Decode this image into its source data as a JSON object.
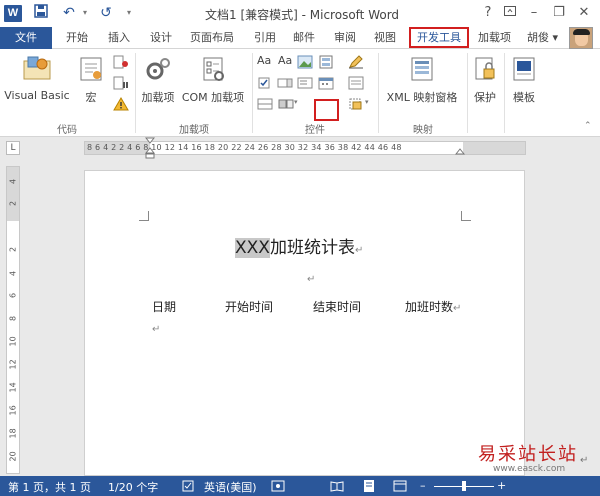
{
  "window": {
    "title": "文档1 [兼容模式] - Microsoft Word",
    "logo": "W",
    "undo": "↶",
    "redo": "↺",
    "help": "?",
    "minimize": "–",
    "restore": "❐",
    "close": "✕"
  },
  "tabs": {
    "file": "文件",
    "home": "开始",
    "insert": "插入",
    "design": "设计",
    "layout": "页面布局",
    "references": "引用",
    "mailings": "邮件",
    "review": "审阅",
    "view": "视图",
    "developer": "开发工具",
    "addins": "加载项",
    "user": "胡俊 ▾"
  },
  "ribbon": {
    "visual_basic": "Visual Basic",
    "macros": "宏",
    "addins": "加载项",
    "com_addins": "COM 加载项",
    "xml_mapping": "XML 映射窗格",
    "protect": "保护",
    "template": "模板",
    "groups": {
      "code": "代码",
      "addins": "加载项",
      "controls": "控件",
      "mapping": "映射"
    }
  },
  "ruler": {
    "corner": "L",
    "ticks": "8  6  4  2     2  4  6  8  10 12 14 16 18 20 22 24 26 28 30 32 34 36 38     42 44 46 48",
    "vertical": [
      "4",
      "2",
      "2",
      "4",
      "6",
      "8",
      "10",
      "12",
      "14",
      "16",
      "18",
      "20"
    ]
  },
  "document": {
    "title_highlight": "XXX",
    "title_rest": "加班统计表",
    "columns": [
      "日期",
      "开始时间",
      "结束时间",
      "加班时数"
    ],
    "para_mark": "↵"
  },
  "status": {
    "page": "第 1 页，共 1 页",
    "words": "1/20 个字",
    "language": "英语(美国)"
  },
  "watermark": {
    "text": "易采站长站",
    "url": "www.easck.com"
  },
  "colors": {
    "brand": "#2b579a",
    "highlight_border": "#d21f1f"
  }
}
